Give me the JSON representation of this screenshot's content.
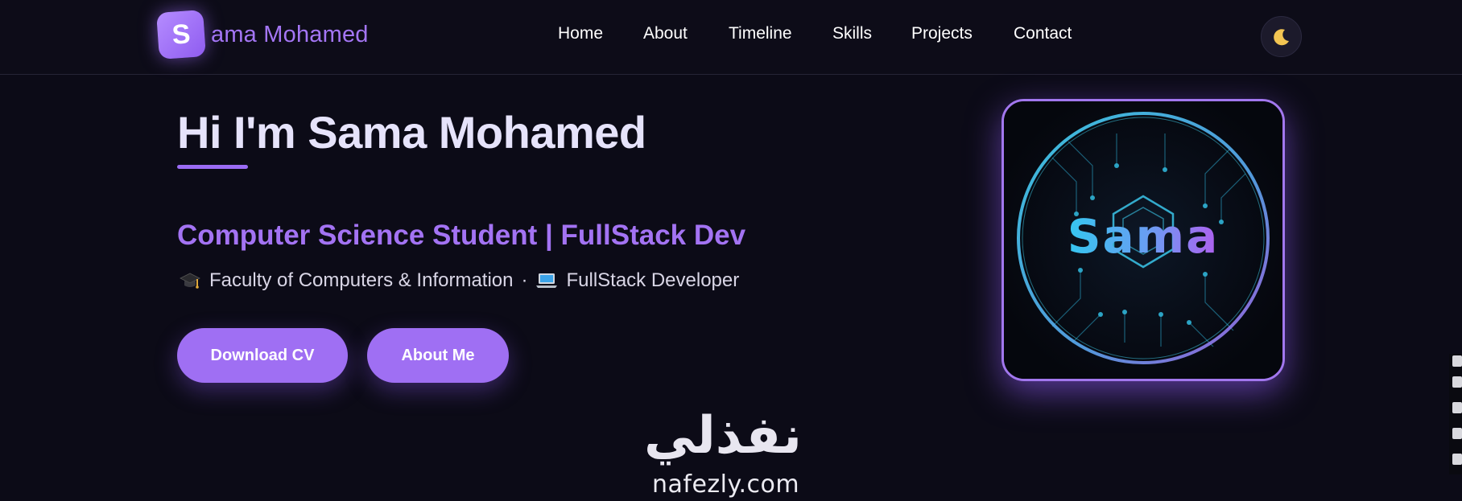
{
  "brand": {
    "badge_letter": "S",
    "text": "ama Mohamed"
  },
  "nav": {
    "links": [
      {
        "label": "Home"
      },
      {
        "label": "About"
      },
      {
        "label": "Timeline"
      },
      {
        "label": "Skills"
      },
      {
        "label": "Projects"
      },
      {
        "label": "Contact"
      }
    ],
    "theme_toggle_icon": "moon-icon"
  },
  "hero": {
    "title": "Hi I'm Sama Mohamed",
    "subtitle": "Computer Science Student | FullStack Dev",
    "info": {
      "faculty": "Faculty of Computers & Information",
      "separator": "·",
      "role": "FullStack Developer",
      "faculty_icon": "graduation-cap-icon",
      "role_icon": "laptop-icon"
    },
    "buttons": {
      "download_cv": "Download CV",
      "about_me": "About Me"
    }
  },
  "profile": {
    "logo_text": "Sama"
  },
  "watermark": {
    "arabic": "نفذلي",
    "latin": "nafezly.com"
  },
  "colors": {
    "background": "#0c0b17",
    "accent": "#9f6ff3",
    "accent_text": "#a373f3",
    "card_border": "#a277ee",
    "logo_cyan": "#37c8ee",
    "logo_purple": "#b066ee"
  }
}
